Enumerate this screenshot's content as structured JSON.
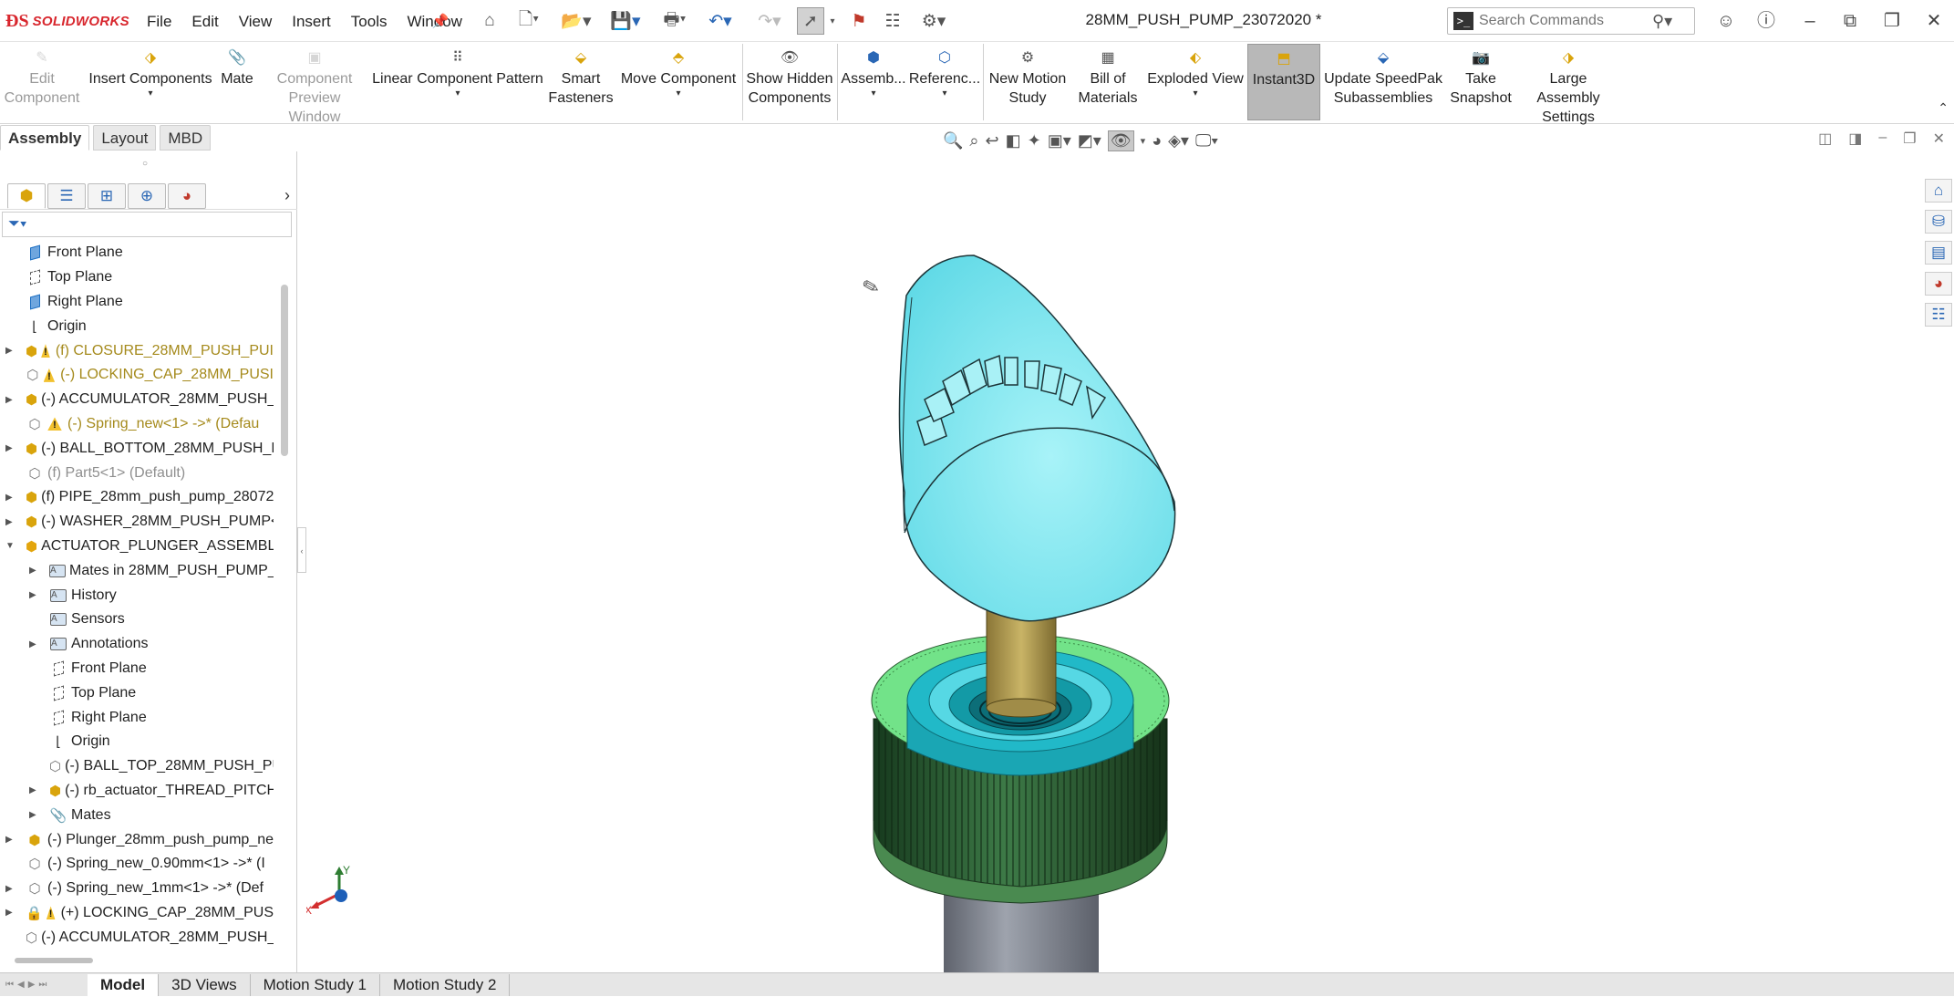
{
  "app": {
    "name": "SOLIDWORKS",
    "document_title": "28MM_PUSH_PUMP_23072020 *"
  },
  "menu": [
    "File",
    "Edit",
    "View",
    "Insert",
    "Tools",
    "Window"
  ],
  "search": {
    "placeholder": "Search Commands"
  },
  "ribbon": {
    "edit_component": [
      "Edit",
      "Component"
    ],
    "insert_components": "Insert Components",
    "mate": "Mate",
    "component_preview": [
      "Component",
      "Preview Window"
    ],
    "linear_pattern": "Linear Component Pattern",
    "smart_fasteners": [
      "Smart",
      "Fasteners"
    ],
    "move_component": "Move Component",
    "show_hidden": [
      "Show Hidden",
      "Components"
    ],
    "assembly": "Assemb...",
    "reference": "Referenc...",
    "motion_study": [
      "New Motion",
      "Study"
    ],
    "bom": [
      "Bill of",
      "Materials"
    ],
    "exploded_view": "Exploded View",
    "instant3d": "Instant3D",
    "speedpak": [
      "Update SpeedPak",
      "Subassemblies"
    ],
    "snapshot": [
      "Take",
      "Snapshot"
    ],
    "large_assembly": [
      "Large Assembly",
      "Settings"
    ]
  },
  "command_tabs": [
    "Assembly",
    "Layout",
    "MBD"
  ],
  "tree": [
    {
      "label": "Front Plane",
      "indent": 0,
      "icon": "plane",
      "expand": false
    },
    {
      "label": "Top Plane",
      "indent": 0,
      "icon": "plane-hollow",
      "expand": false
    },
    {
      "label": "Right Plane",
      "indent": 0,
      "icon": "plane",
      "expand": false
    },
    {
      "label": "Origin",
      "indent": 0,
      "icon": "origin",
      "expand": false
    },
    {
      "label": "(f) CLOSURE_28MM_PUSH_PUI",
      "indent": 0,
      "icon": "part",
      "expand": true,
      "warn": true,
      "style": "amber"
    },
    {
      "label": "(-) LOCKING_CAP_28MM_PUSI",
      "indent": 0,
      "icon": "part-hollow",
      "expand": false,
      "warn": true,
      "style": "amber"
    },
    {
      "label": "(-) ACCUMULATOR_28MM_PUSH_",
      "indent": 0,
      "icon": "part",
      "expand": true
    },
    {
      "label": "(-) Spring_new<1> ->* (Defau",
      "indent": 0,
      "icon": "part-hollow",
      "expand": false,
      "warn": true,
      "style": "amber"
    },
    {
      "label": "(-) BALL_BOTTOM_28MM_PUSH_P",
      "indent": 0,
      "icon": "part",
      "expand": true
    },
    {
      "label": "(f) Part5<1> (Default)",
      "indent": 0,
      "icon": "part-fixed",
      "expand": false,
      "style": "grey"
    },
    {
      "label": "(f) PIPE_28mm_push_pump_28072",
      "indent": 0,
      "icon": "part",
      "expand": true
    },
    {
      "label": "(-) WASHER_28MM_PUSH_PUMP<",
      "indent": 0,
      "icon": "part",
      "expand": true
    },
    {
      "label": "ACTUATOR_PLUNGER_ASSEMBLY",
      "indent": 0,
      "icon": "asm",
      "expand": "open"
    },
    {
      "label": "Mates in 28MM_PUSH_PUMP_2",
      "indent": 1,
      "icon": "folder",
      "expand": true
    },
    {
      "label": "History",
      "indent": 1,
      "icon": "folder",
      "expand": true
    },
    {
      "label": "Sensors",
      "indent": 1,
      "icon": "folder",
      "expand": false
    },
    {
      "label": "Annotations",
      "indent": 1,
      "icon": "folder",
      "expand": true
    },
    {
      "label": "Front Plane",
      "indent": 1,
      "icon": "plane-hollow",
      "expand": false
    },
    {
      "label": "Top Plane",
      "indent": 1,
      "icon": "plane-hollow",
      "expand": false
    },
    {
      "label": "Right Plane",
      "indent": 1,
      "icon": "plane-hollow",
      "expand": false
    },
    {
      "label": "Origin",
      "indent": 1,
      "icon": "origin",
      "expand": false
    },
    {
      "label": "(-) BALL_TOP_28MM_PUSH_PU",
      "indent": 1,
      "icon": "part-hollow",
      "expand": false
    },
    {
      "label": "(-) rb_actuator_THREAD_PITCH",
      "indent": 1,
      "icon": "part",
      "expand": true
    },
    {
      "label": "Mates",
      "indent": 1,
      "icon": "mates",
      "expand": true
    },
    {
      "label": "(-) Plunger_28mm_push_pump_ne",
      "indent": 0,
      "icon": "part",
      "expand": true
    },
    {
      "label": "(-) Spring_new_0.90mm<1> ->* (I",
      "indent": 0,
      "icon": "part-hollow",
      "expand": false
    },
    {
      "label": "(-) Spring_new_1mm<1> ->* (Def",
      "indent": 0,
      "icon": "part-hollow",
      "expand": true
    },
    {
      "label": "(+) LOCKING_CAP_28MM_PUS",
      "indent": 0,
      "icon": "part-locked",
      "expand": true,
      "warn": true
    },
    {
      "label": "(-) ACCUMULATOR_28MM_PUSH_",
      "indent": 0,
      "icon": "part-hollow",
      "expand": false
    }
  ],
  "bottom_tabs": [
    "Model",
    "3D Views",
    "Motion Study 1",
    "Motion Study 2"
  ],
  "triad": {
    "x": "X",
    "y": "Y"
  },
  "colors": {
    "actuator": "#7de9f2",
    "collar": "#6fe09a",
    "closure": "#2f6b3a",
    "stem": "#b09a4f",
    "pipe": "#7b7f8a"
  }
}
